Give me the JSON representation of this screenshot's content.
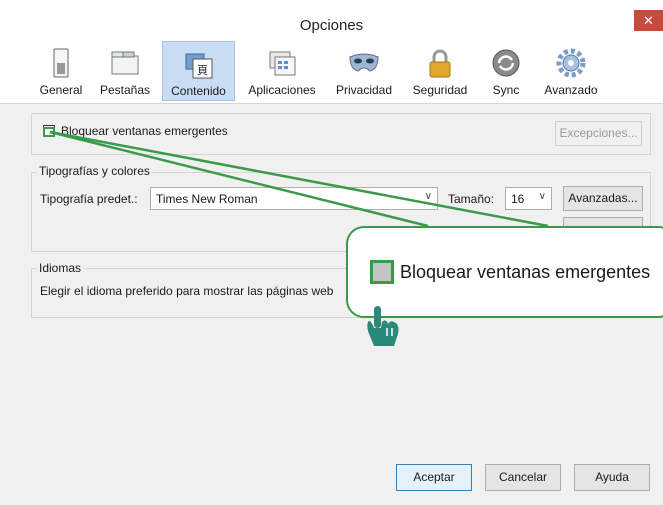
{
  "window": {
    "title": "Opciones",
    "close_glyph": "✕"
  },
  "toolbar": {
    "items": [
      {
        "label": "General",
        "icon": "switch-icon"
      },
      {
        "label": "Pestañas",
        "icon": "tabs-icon"
      },
      {
        "label": "Contenido",
        "icon": "content-icon",
        "active": true
      },
      {
        "label": "Aplicaciones",
        "icon": "apps-icon"
      },
      {
        "label": "Privacidad",
        "icon": "mask-icon"
      },
      {
        "label": "Seguridad",
        "icon": "lock-icon"
      },
      {
        "label": "Sync",
        "icon": "sync-icon"
      },
      {
        "label": "Avanzado",
        "icon": "gear-icon"
      }
    ]
  },
  "popups": {
    "checkbox_label": "Bloquear ventanas emergentes",
    "checked": false,
    "exceptions_label": "Excepciones..."
  },
  "fonts": {
    "section_label": "Tipografías y colores",
    "default_font_label": "Tipografía predet.:",
    "default_font_value": "Times New Roman",
    "size_label": "Tamaño:",
    "size_value": "16",
    "advanced_label": "Avanzadas..."
  },
  "languages": {
    "section_label": "Idiomas",
    "description": "Elegir el idioma preferido para mostrar las páginas web"
  },
  "callout": {
    "label": "Bloquear ventanas emergentes"
  },
  "footer": {
    "accept_label": "Aceptar",
    "cancel_label": "Cancelar",
    "help_label": "Ayuda"
  },
  "colors": {
    "accent_green": "#3a9a4a",
    "hand_teal": "#2a8a7a",
    "active_tab": "#c8dcf4"
  }
}
